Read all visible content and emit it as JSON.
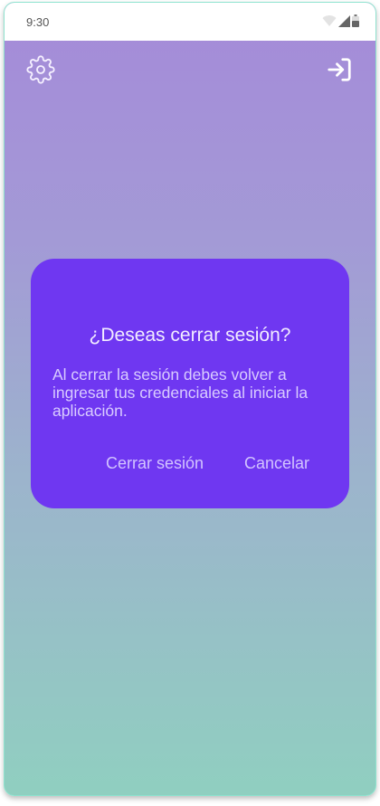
{
  "status_bar": {
    "time": "9:30",
    "icons": [
      "wifi-icon",
      "signal-icon",
      "battery-icon"
    ]
  },
  "top_bar": {
    "left_icon": "gear-icon",
    "right_icon": "login-icon"
  },
  "dialog": {
    "title": "¿Deseas cerrar sesión?",
    "message": "Al cerrar la sesión debes volver a ingresar tus credenciales al iniciar la aplicación.",
    "confirm_label": "Cerrar sesión",
    "cancel_label": "Cancelar"
  },
  "colors": {
    "dialog_background": "#6f37f1",
    "background_top": "#a58ad9",
    "background_bottom": "#90cfc0"
  }
}
